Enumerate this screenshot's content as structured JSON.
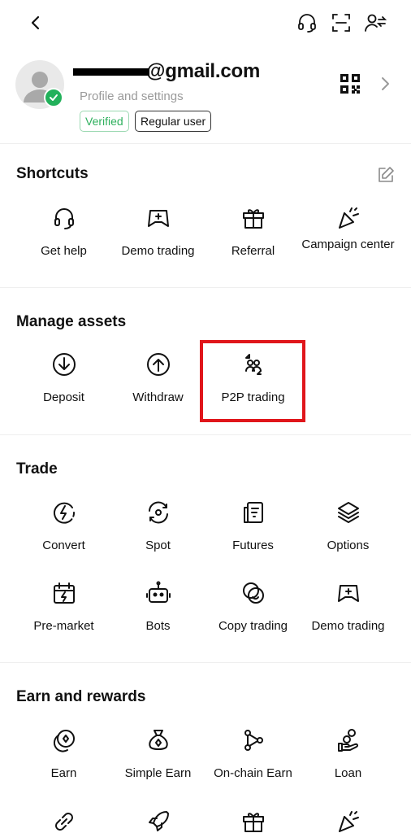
{
  "header": {
    "icons": [
      "back-arrow-icon",
      "headset-icon",
      "scan-icon",
      "account-switch-icon"
    ]
  },
  "profile": {
    "email": "@gmail.com",
    "subtitle": "Profile and settings",
    "badge_verified": "Verified",
    "badge_user": "Regular user",
    "accent_green": "#22b15b"
  },
  "shortcuts": {
    "title": "Shortcuts",
    "items": [
      {
        "label": "Get help",
        "icon": "headset-icon"
      },
      {
        "label": "Demo trading",
        "icon": "gamepad-plus-icon"
      },
      {
        "label": "Referral",
        "icon": "gift-icon"
      },
      {
        "label": "Campaign center",
        "icon": "party-popper-icon"
      }
    ]
  },
  "manage_assets": {
    "title": "Manage assets",
    "items": [
      {
        "label": "Deposit",
        "icon": "deposit-arrow-icon"
      },
      {
        "label": "Withdraw",
        "icon": "withdraw-arrow-icon"
      },
      {
        "label": "P2P trading",
        "icon": "p2p-users-icon"
      }
    ],
    "highlight_color": "#e0161b"
  },
  "trade": {
    "title": "Trade",
    "items": [
      {
        "label": "Convert",
        "icon": "convert-bolt-icon"
      },
      {
        "label": "Spot",
        "icon": "spot-cycle-icon"
      },
      {
        "label": "Futures",
        "icon": "futures-doc-icon"
      },
      {
        "label": "Options",
        "icon": "layers-icon"
      },
      {
        "label": "Pre-market",
        "icon": "calendar-bolt-icon"
      },
      {
        "label": "Bots",
        "icon": "robot-icon"
      },
      {
        "label": "Copy trading",
        "icon": "copy-circles-icon"
      },
      {
        "label": "Demo trading",
        "icon": "gamepad-plus-icon"
      }
    ]
  },
  "earn": {
    "title": "Earn and rewards",
    "items": [
      {
        "label": "Earn",
        "icon": "earn-coin-icon"
      },
      {
        "label": "Simple Earn",
        "icon": "money-bag-icon"
      },
      {
        "label": "On-chain Earn",
        "icon": "nodes-icon"
      },
      {
        "label": "Loan",
        "icon": "hand-coin-icon"
      }
    ],
    "more_icons": [
      "link-icon",
      "rocket-icon",
      "gift-icon",
      "party-popper-icon"
    ]
  }
}
